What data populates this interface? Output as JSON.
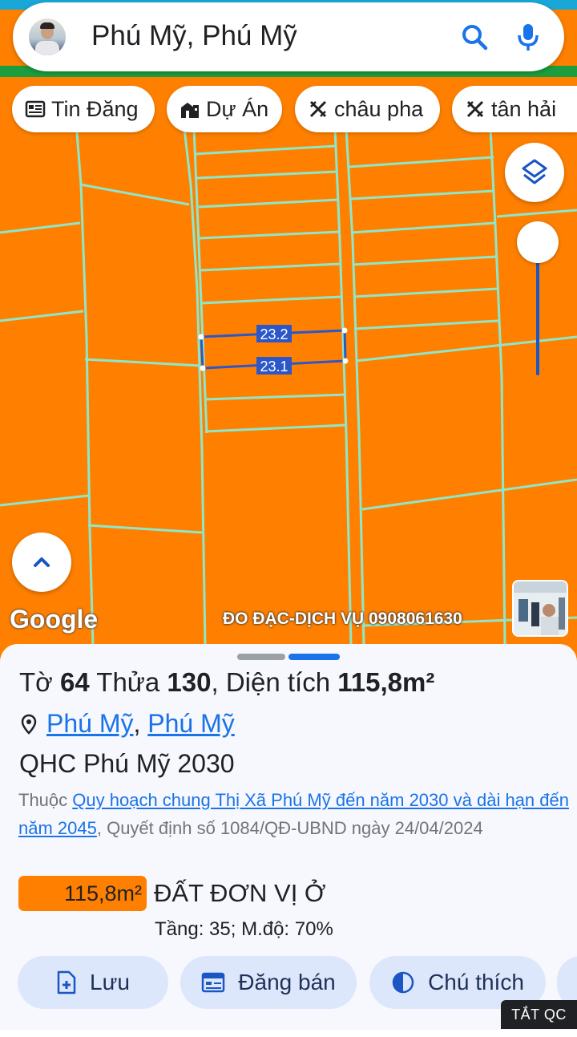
{
  "search": {
    "query": "Phú Mỹ, Phú Mỹ"
  },
  "chips": [
    {
      "label": "Tin Đăng",
      "icon": "newspaper-icon"
    },
    {
      "label": "Dự Án",
      "icon": "building-icon"
    },
    {
      "label": "châu pha",
      "icon": "crosshair-icon"
    },
    {
      "label": "tân hải",
      "icon": "crosshair-icon"
    }
  ],
  "map": {
    "parcel_labels": [
      "23.2",
      "23.1"
    ],
    "google_logo": "Google",
    "attribution": "ĐO ĐẠC-DỊCH VỤ 0908061630",
    "colors": {
      "land": "#ff8000",
      "boundary": "#8fe6c9",
      "selection": "#2c57c9"
    }
  },
  "parcel": {
    "sheet_label": "Tờ",
    "sheet_no": "64",
    "lot_label": "Thửa",
    "lot_no": "130",
    "area_label": ", Diện tích",
    "area": "115,8m²",
    "ward": "Phú Mỹ",
    "town": "Phú Mỹ",
    "separator": ",",
    "plan_title": "QHC Phú Mỹ 2030",
    "plan_prefix": "Thuộc",
    "plan_link": "Quy hoạch chung Thị Xã Phú Mỹ đến năm 2030 và dài hạn đến năm 2045",
    "plan_decision": ", Quyết định số 1084/QĐ-UBND ngày 24/04/2024",
    "land_area": "115,8m²",
    "land_type": "ĐẤT ĐƠN VỊ Ở",
    "land_meta": "Tầng: 35; M.độ: 70%"
  },
  "actions": [
    {
      "label": "Lưu",
      "icon": "add-document-icon"
    },
    {
      "label": "Đăng bán",
      "icon": "listing-icon"
    },
    {
      "label": "Chú thích",
      "icon": "contrast-icon"
    }
  ],
  "ad": {
    "label": "TẮT QC"
  }
}
